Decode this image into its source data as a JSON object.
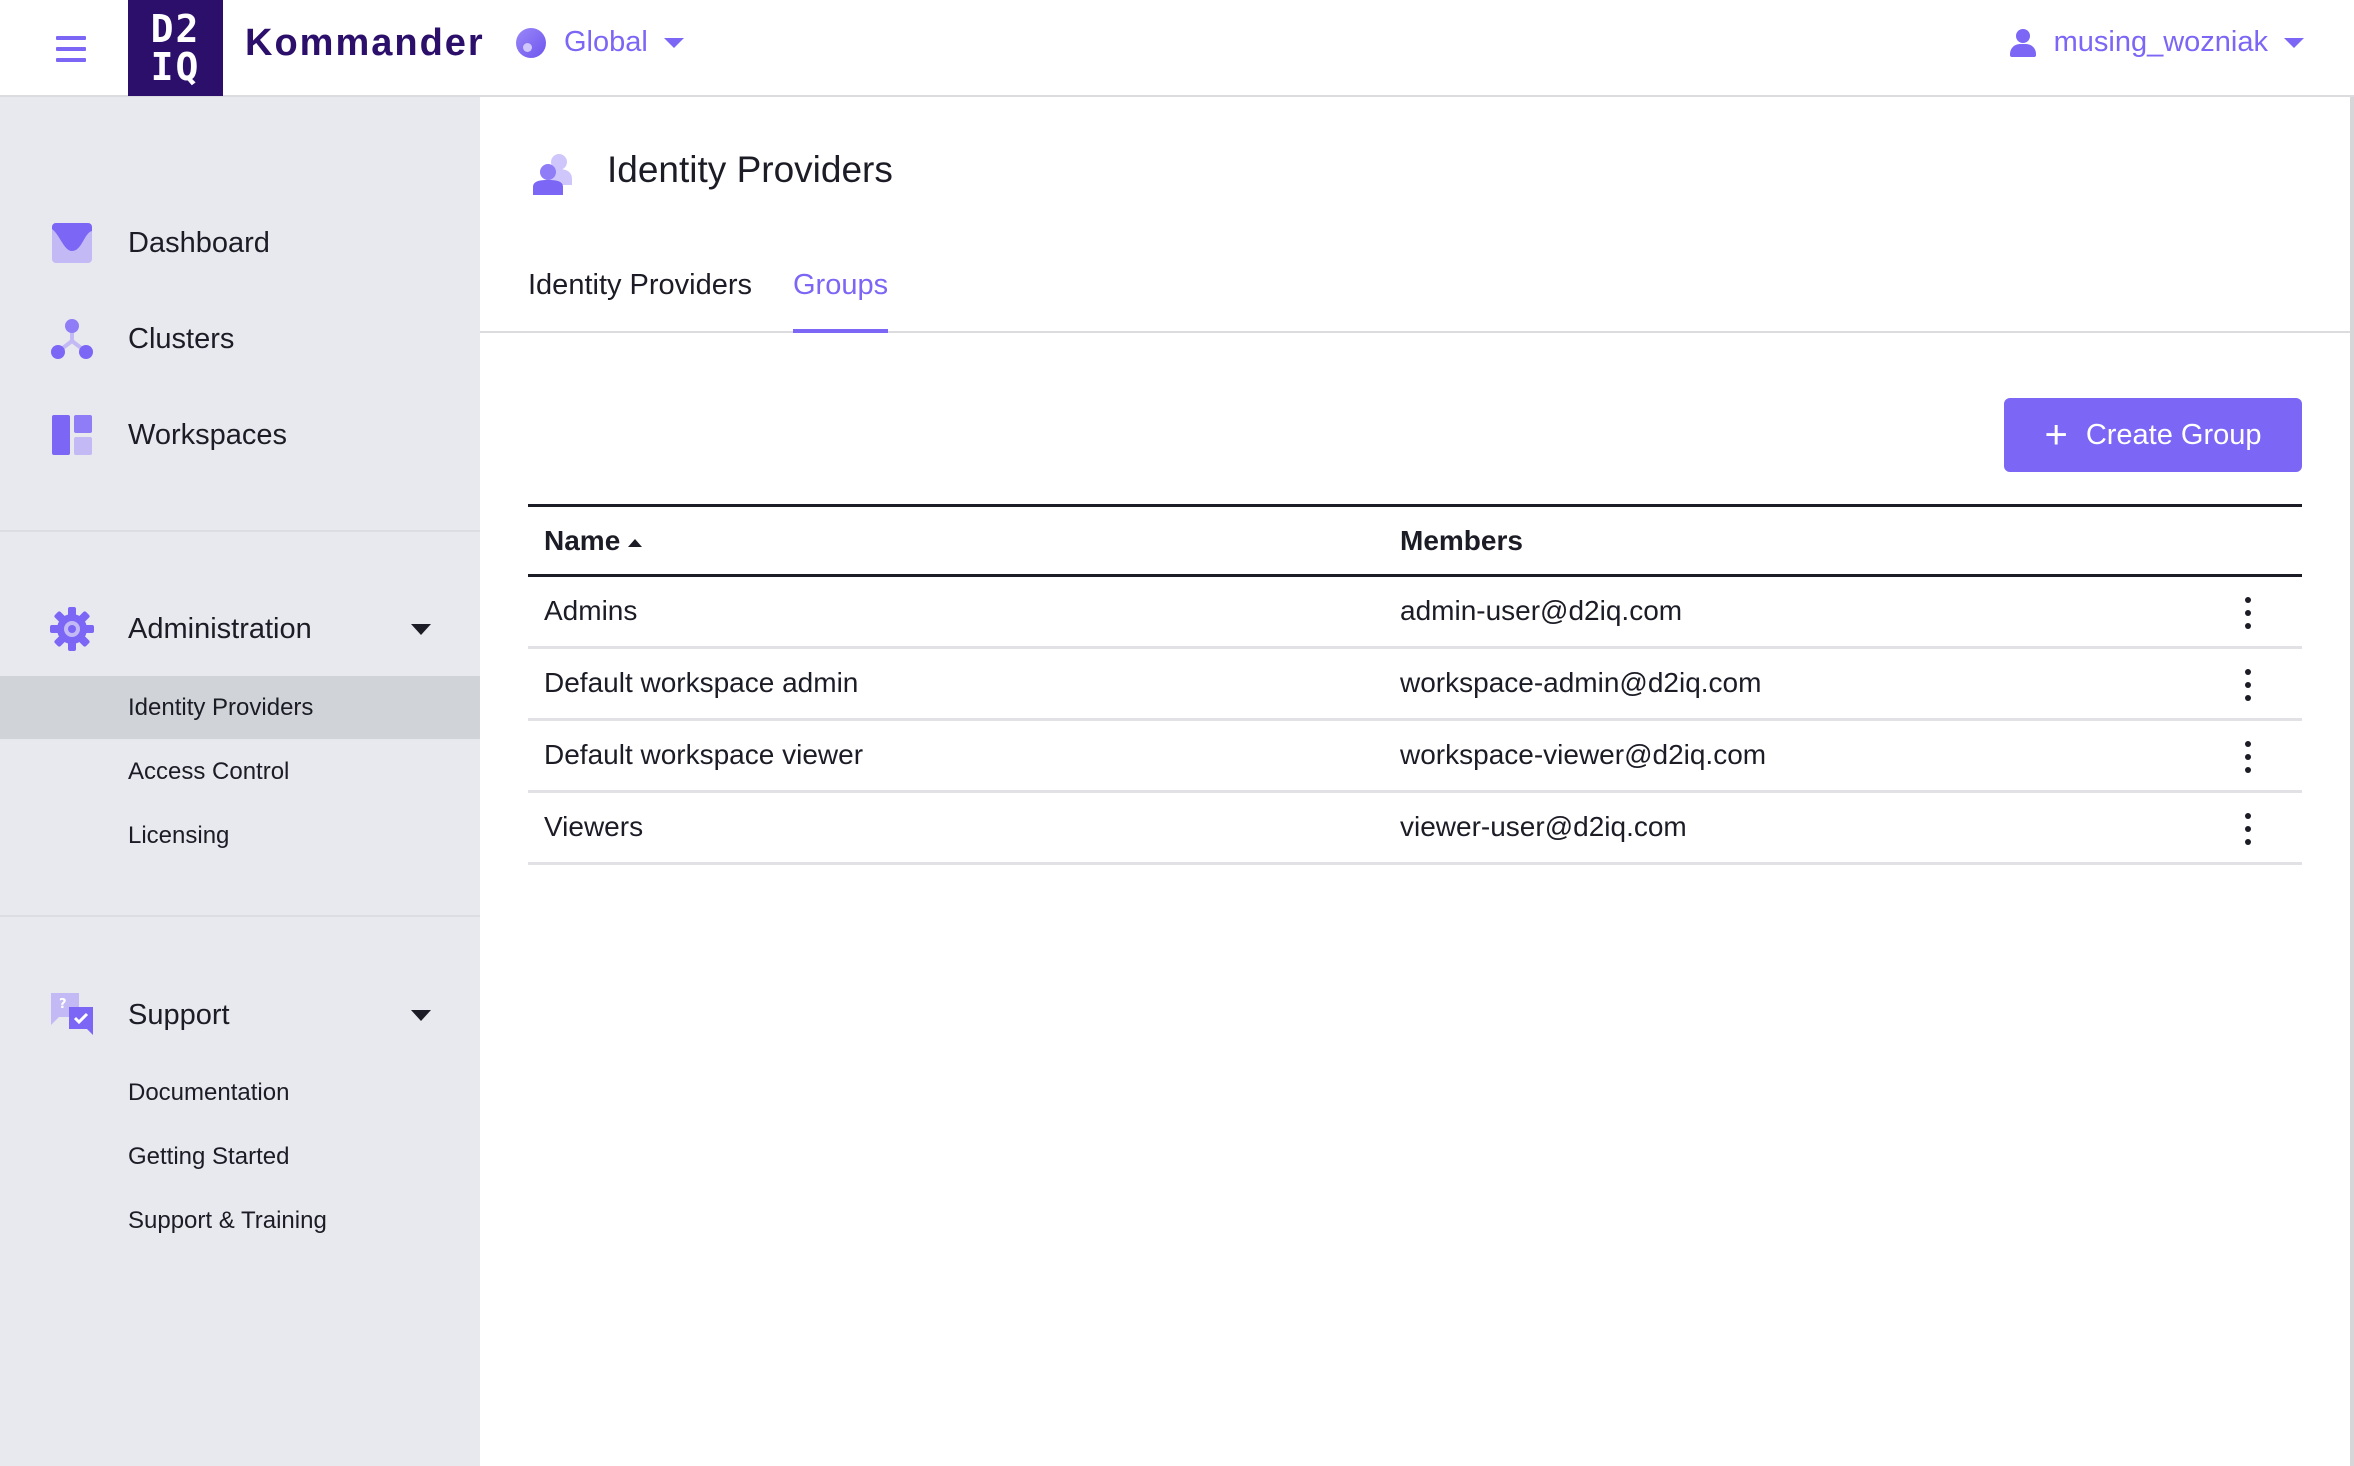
{
  "header": {
    "brand_logo_line1": "D2",
    "brand_logo_line2": "IQ",
    "app_name": "Kommander",
    "scope": {
      "label": "Global",
      "icon": "globe-dot-icon"
    },
    "user": {
      "name": "musing_wozniak",
      "icon": "user-icon"
    },
    "menu_icon": "hamburger-icon"
  },
  "sidebar": {
    "primary": [
      {
        "label": "Dashboard",
        "icon": "dashboard-icon"
      },
      {
        "label": "Clusters",
        "icon": "clusters-icon"
      },
      {
        "label": "Workspaces",
        "icon": "workspaces-icon"
      }
    ],
    "administration": {
      "label": "Administration",
      "icon": "gear-icon",
      "expanded": true,
      "items": [
        {
          "label": "Identity Providers",
          "active": true
        },
        {
          "label": "Access Control",
          "active": false
        },
        {
          "label": "Licensing",
          "active": false
        }
      ]
    },
    "support": {
      "label": "Support",
      "icon": "support-chat-icon",
      "expanded": true,
      "items": [
        {
          "label": "Documentation"
        },
        {
          "label": "Getting Started"
        },
        {
          "label": "Support & Training"
        }
      ]
    }
  },
  "main": {
    "page_title": "Identity Providers",
    "page_icon": "users-icon",
    "tabs": [
      {
        "label": "Identity Providers",
        "active": false
      },
      {
        "label": "Groups",
        "active": true
      }
    ],
    "create_button_label": "Create Group",
    "table": {
      "columns": [
        {
          "label": "Name",
          "sort": "ascending"
        },
        {
          "label": "Members"
        }
      ],
      "rows": [
        {
          "name": "Admins",
          "members": "admin-user@d2iq.com"
        },
        {
          "name": "Default workspace admin",
          "members": "workspace-admin@d2iq.com"
        },
        {
          "name": "Default workspace viewer",
          "members": "workspace-viewer@d2iq.com"
        },
        {
          "name": "Viewers",
          "members": "viewer-user@d2iq.com"
        }
      ]
    }
  },
  "colors": {
    "accent": "#7b66f5",
    "brand_dark": "#2b0f6b",
    "sidebar_bg": "#e8e9ee",
    "active_item_bg": "#d0d3d7",
    "text": "#1b1c25"
  }
}
